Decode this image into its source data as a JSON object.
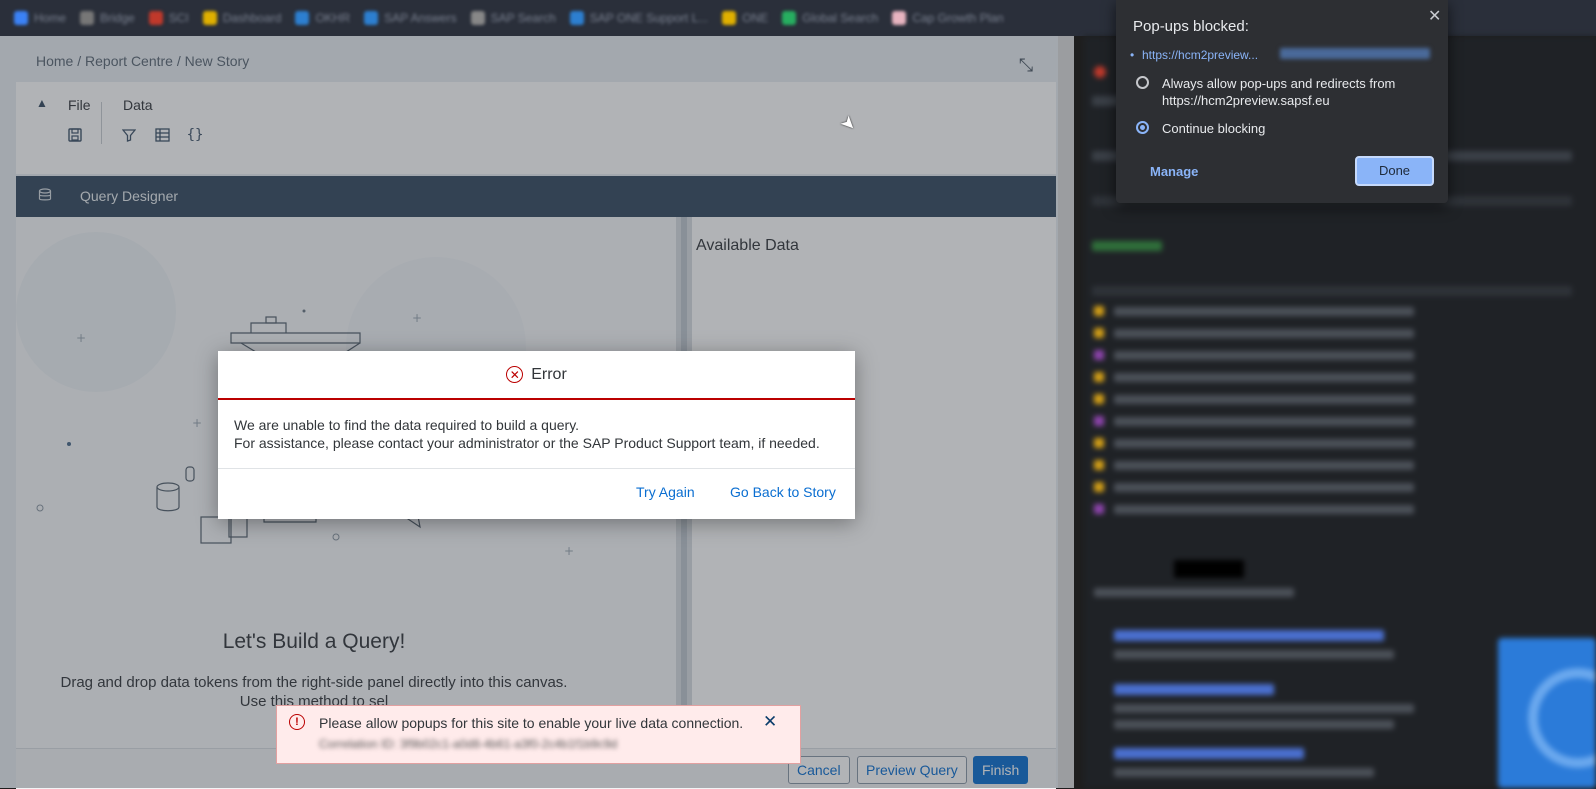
{
  "browser": {
    "bookmarks": [
      "Home",
      "Bridge",
      "SCI",
      "Dashboard",
      "OKHR",
      "SAP Answers",
      "SAP Search",
      "SAP ONE Support L...",
      "ONE",
      "Global Search",
      "Cap Growth Plan"
    ]
  },
  "breadcrumb": {
    "home": "Home",
    "sep1": " / ",
    "report_centre": "Report Centre",
    "sep2": " / ",
    "current": "New Story"
  },
  "toolbar": {
    "file_label": "File",
    "data_label": "Data"
  },
  "query_designer": {
    "title": "Query Designer",
    "empty_title": "Let's Build a Query!",
    "empty_text": "Drag and drop data tokens from the right-side panel directly into this canvas. Use this method to sel"
  },
  "available_data": {
    "title": "Available Data"
  },
  "footer": {
    "cancel": "Cancel",
    "preview": "Preview Query",
    "finish": "Finish"
  },
  "error_dialog": {
    "title": "Error",
    "line1": "We are unable to find the data required to build a query.",
    "line2": "For assistance, please contact your administrator or the SAP Product Support team, if needed.",
    "try_again": "Try Again",
    "go_back": "Go Back to Story"
  },
  "toast": {
    "message": "Please allow popups for this site to enable your live data connection.",
    "sub": "Correlation ID: 3f9b02c1-a0d8-4b61-a3f0-2c4b1f1b9c9d"
  },
  "popup_blocked": {
    "title": "Pop-ups blocked:",
    "url": "https://hcm2preview...",
    "option_allow": "Always allow pop-ups and redirects from https://hcm2preview.sapsf.eu",
    "option_block": "Continue blocking",
    "selected_option": "Continue blocking",
    "manage": "Manage",
    "done": "Done"
  },
  "colors": {
    "error": "#bb0000",
    "link": "#0a6ed1",
    "shell": "#354a5f",
    "popup_accent": "#8ab4f8"
  }
}
